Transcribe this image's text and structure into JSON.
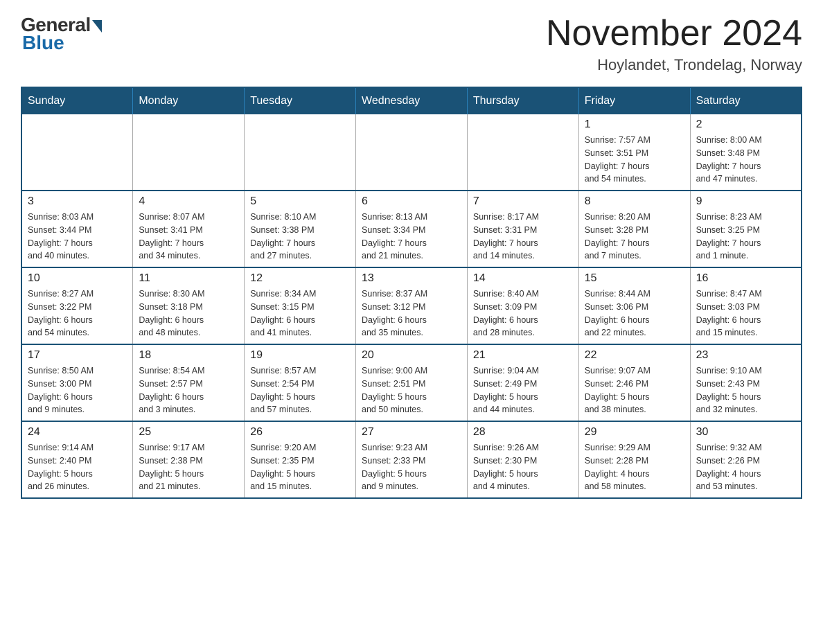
{
  "logo": {
    "general": "General",
    "blue": "Blue"
  },
  "header": {
    "month_year": "November 2024",
    "location": "Hoylandet, Trondelag, Norway"
  },
  "weekdays": [
    "Sunday",
    "Monday",
    "Tuesday",
    "Wednesday",
    "Thursday",
    "Friday",
    "Saturday"
  ],
  "weeks": [
    [
      {
        "day": "",
        "info": ""
      },
      {
        "day": "",
        "info": ""
      },
      {
        "day": "",
        "info": ""
      },
      {
        "day": "",
        "info": ""
      },
      {
        "day": "",
        "info": ""
      },
      {
        "day": "1",
        "info": "Sunrise: 7:57 AM\nSunset: 3:51 PM\nDaylight: 7 hours\nand 54 minutes."
      },
      {
        "day": "2",
        "info": "Sunrise: 8:00 AM\nSunset: 3:48 PM\nDaylight: 7 hours\nand 47 minutes."
      }
    ],
    [
      {
        "day": "3",
        "info": "Sunrise: 8:03 AM\nSunset: 3:44 PM\nDaylight: 7 hours\nand 40 minutes."
      },
      {
        "day": "4",
        "info": "Sunrise: 8:07 AM\nSunset: 3:41 PM\nDaylight: 7 hours\nand 34 minutes."
      },
      {
        "day": "5",
        "info": "Sunrise: 8:10 AM\nSunset: 3:38 PM\nDaylight: 7 hours\nand 27 minutes."
      },
      {
        "day": "6",
        "info": "Sunrise: 8:13 AM\nSunset: 3:34 PM\nDaylight: 7 hours\nand 21 minutes."
      },
      {
        "day": "7",
        "info": "Sunrise: 8:17 AM\nSunset: 3:31 PM\nDaylight: 7 hours\nand 14 minutes."
      },
      {
        "day": "8",
        "info": "Sunrise: 8:20 AM\nSunset: 3:28 PM\nDaylight: 7 hours\nand 7 minutes."
      },
      {
        "day": "9",
        "info": "Sunrise: 8:23 AM\nSunset: 3:25 PM\nDaylight: 7 hours\nand 1 minute."
      }
    ],
    [
      {
        "day": "10",
        "info": "Sunrise: 8:27 AM\nSunset: 3:22 PM\nDaylight: 6 hours\nand 54 minutes."
      },
      {
        "day": "11",
        "info": "Sunrise: 8:30 AM\nSunset: 3:18 PM\nDaylight: 6 hours\nand 48 minutes."
      },
      {
        "day": "12",
        "info": "Sunrise: 8:34 AM\nSunset: 3:15 PM\nDaylight: 6 hours\nand 41 minutes."
      },
      {
        "day": "13",
        "info": "Sunrise: 8:37 AM\nSunset: 3:12 PM\nDaylight: 6 hours\nand 35 minutes."
      },
      {
        "day": "14",
        "info": "Sunrise: 8:40 AM\nSunset: 3:09 PM\nDaylight: 6 hours\nand 28 minutes."
      },
      {
        "day": "15",
        "info": "Sunrise: 8:44 AM\nSunset: 3:06 PM\nDaylight: 6 hours\nand 22 minutes."
      },
      {
        "day": "16",
        "info": "Sunrise: 8:47 AM\nSunset: 3:03 PM\nDaylight: 6 hours\nand 15 minutes."
      }
    ],
    [
      {
        "day": "17",
        "info": "Sunrise: 8:50 AM\nSunset: 3:00 PM\nDaylight: 6 hours\nand 9 minutes."
      },
      {
        "day": "18",
        "info": "Sunrise: 8:54 AM\nSunset: 2:57 PM\nDaylight: 6 hours\nand 3 minutes."
      },
      {
        "day": "19",
        "info": "Sunrise: 8:57 AM\nSunset: 2:54 PM\nDaylight: 5 hours\nand 57 minutes."
      },
      {
        "day": "20",
        "info": "Sunrise: 9:00 AM\nSunset: 2:51 PM\nDaylight: 5 hours\nand 50 minutes."
      },
      {
        "day": "21",
        "info": "Sunrise: 9:04 AM\nSunset: 2:49 PM\nDaylight: 5 hours\nand 44 minutes."
      },
      {
        "day": "22",
        "info": "Sunrise: 9:07 AM\nSunset: 2:46 PM\nDaylight: 5 hours\nand 38 minutes."
      },
      {
        "day": "23",
        "info": "Sunrise: 9:10 AM\nSunset: 2:43 PM\nDaylight: 5 hours\nand 32 minutes."
      }
    ],
    [
      {
        "day": "24",
        "info": "Sunrise: 9:14 AM\nSunset: 2:40 PM\nDaylight: 5 hours\nand 26 minutes."
      },
      {
        "day": "25",
        "info": "Sunrise: 9:17 AM\nSunset: 2:38 PM\nDaylight: 5 hours\nand 21 minutes."
      },
      {
        "day": "26",
        "info": "Sunrise: 9:20 AM\nSunset: 2:35 PM\nDaylight: 5 hours\nand 15 minutes."
      },
      {
        "day": "27",
        "info": "Sunrise: 9:23 AM\nSunset: 2:33 PM\nDaylight: 5 hours\nand 9 minutes."
      },
      {
        "day": "28",
        "info": "Sunrise: 9:26 AM\nSunset: 2:30 PM\nDaylight: 5 hours\nand 4 minutes."
      },
      {
        "day": "29",
        "info": "Sunrise: 9:29 AM\nSunset: 2:28 PM\nDaylight: 4 hours\nand 58 minutes."
      },
      {
        "day": "30",
        "info": "Sunrise: 9:32 AM\nSunset: 2:26 PM\nDaylight: 4 hours\nand 53 minutes."
      }
    ]
  ]
}
